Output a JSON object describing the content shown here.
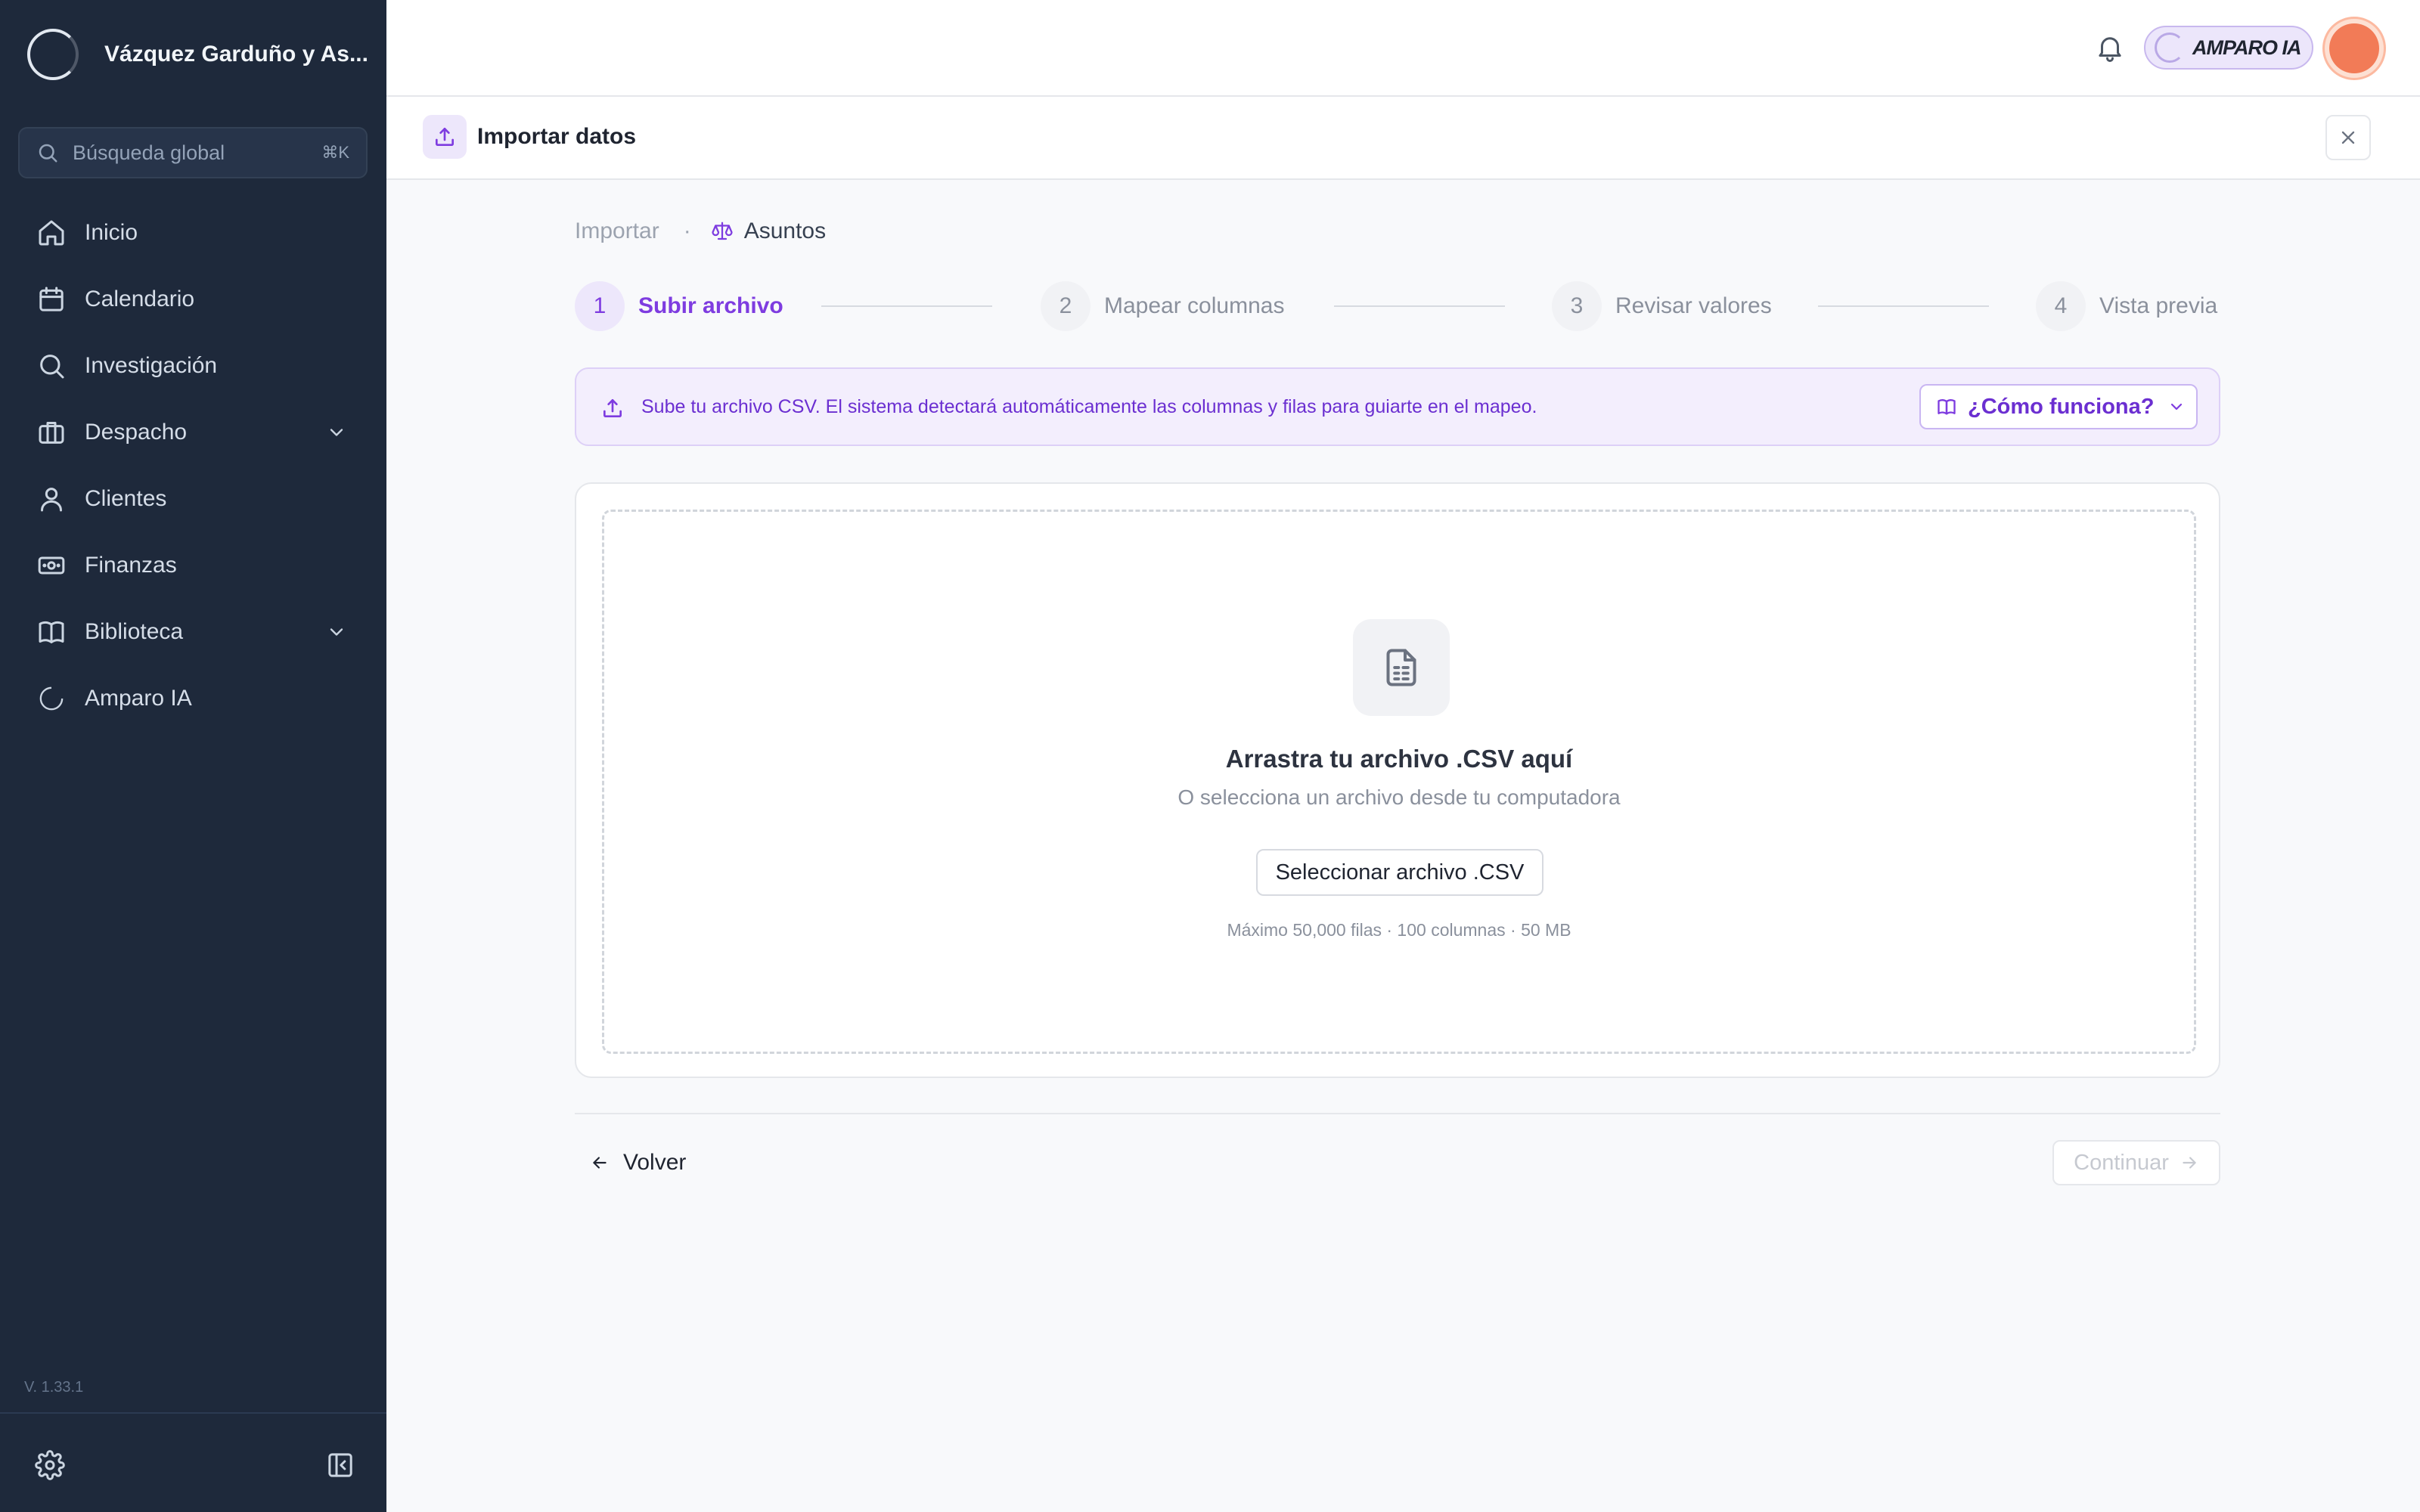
{
  "sidebar": {
    "org_name": "Vázquez Garduño y As...",
    "search": {
      "placeholder": "Búsqueda global",
      "shortcut": "⌘K"
    },
    "items": [
      {
        "label": "Inicio",
        "icon": "home-icon"
      },
      {
        "label": "Calendario",
        "icon": "calendar-icon"
      },
      {
        "label": "Investigación",
        "icon": "search-icon"
      },
      {
        "label": "Despacho",
        "icon": "briefcase-icon",
        "expandable": true
      },
      {
        "label": "Clientes",
        "icon": "user-icon"
      },
      {
        "label": "Finanzas",
        "icon": "money-icon"
      },
      {
        "label": "Biblioteca",
        "icon": "book-icon",
        "expandable": true
      },
      {
        "label": "Amparo IA",
        "icon": "amparo-ring-icon"
      }
    ],
    "version": "V. 1.33.1"
  },
  "topbar": {
    "ai_pill_label": "AMPARO IA"
  },
  "panel": {
    "title": "Importar datos"
  },
  "breadcrumb": {
    "root": "Importar",
    "separator": "·",
    "current": "Asuntos"
  },
  "steps": [
    {
      "number": "1",
      "label": "Subir archivo",
      "active": true
    },
    {
      "number": "2",
      "label": "Mapear columnas",
      "active": false
    },
    {
      "number": "3",
      "label": "Revisar valores",
      "active": false
    },
    {
      "number": "4",
      "label": "Vista previa",
      "active": false
    }
  ],
  "banner": {
    "text": "Sube tu archivo CSV. El sistema detectará automáticamente las columnas y filas para guiarte en el mapeo.",
    "help_button": "¿Cómo funciona?"
  },
  "dropzone": {
    "title": "Arrastra tu archivo .CSV aquí",
    "subtitle": "O selecciona un archivo desde tu computadora",
    "button": "Seleccionar archivo .CSV",
    "limits": "Máximo 50,000 filas · 100 columnas · 50 MB"
  },
  "footer": {
    "back": "Volver",
    "continue": "Continuar"
  },
  "colors": {
    "sidebar_bg": "#1e293b",
    "accent": "#7e3ce0",
    "accent_soft": "#ede7fb"
  }
}
